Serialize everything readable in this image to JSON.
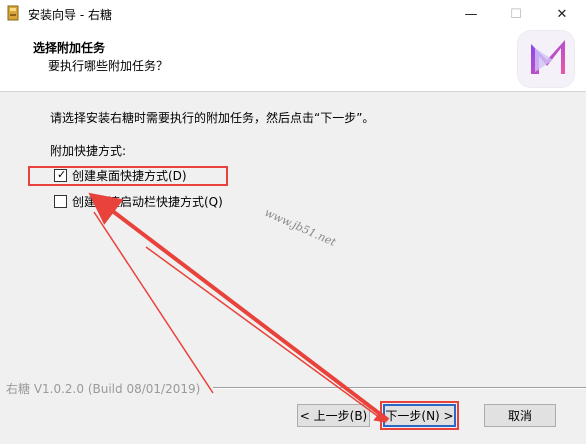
{
  "window": {
    "title": "安装向导 - 右糖",
    "minimize_glyph": "—",
    "maximize_glyph": "☐",
    "close_glyph": "✕"
  },
  "header": {
    "title": "选择附加任务",
    "subtitle": "要执行哪些附加任务？"
  },
  "body": {
    "instruction": "请选择安装右糖时需要执行的附加任务，然后点击“下一步”。",
    "group_label": "附加快捷方式:",
    "tasks": [
      {
        "label": "创建桌面快捷方式(D)",
        "checked": true
      },
      {
        "label": "创建快速启动栏快捷方式(Q)",
        "checked": false
      }
    ],
    "check_glyph": "✓"
  },
  "watermark": "www.jb51.net",
  "footer": {
    "version": "右糖 V1.0.2.0 (Build 08/01/2019)"
  },
  "buttons": {
    "back": "< 上一步(B)",
    "next": "下一步(N) >",
    "cancel": "取消"
  },
  "colors": {
    "annotation_red": "#e8423a",
    "focus_blue": "#2a69c8",
    "logo_purple": "#8a3cf0",
    "logo_pink": "#e84aa8"
  },
  "icons": [
    "app-icon",
    "minimize-icon",
    "maximize-icon",
    "close-icon",
    "logo-icon",
    "checkbox-checked-icon",
    "checkbox-unchecked-icon",
    "annotation-arrow"
  ]
}
